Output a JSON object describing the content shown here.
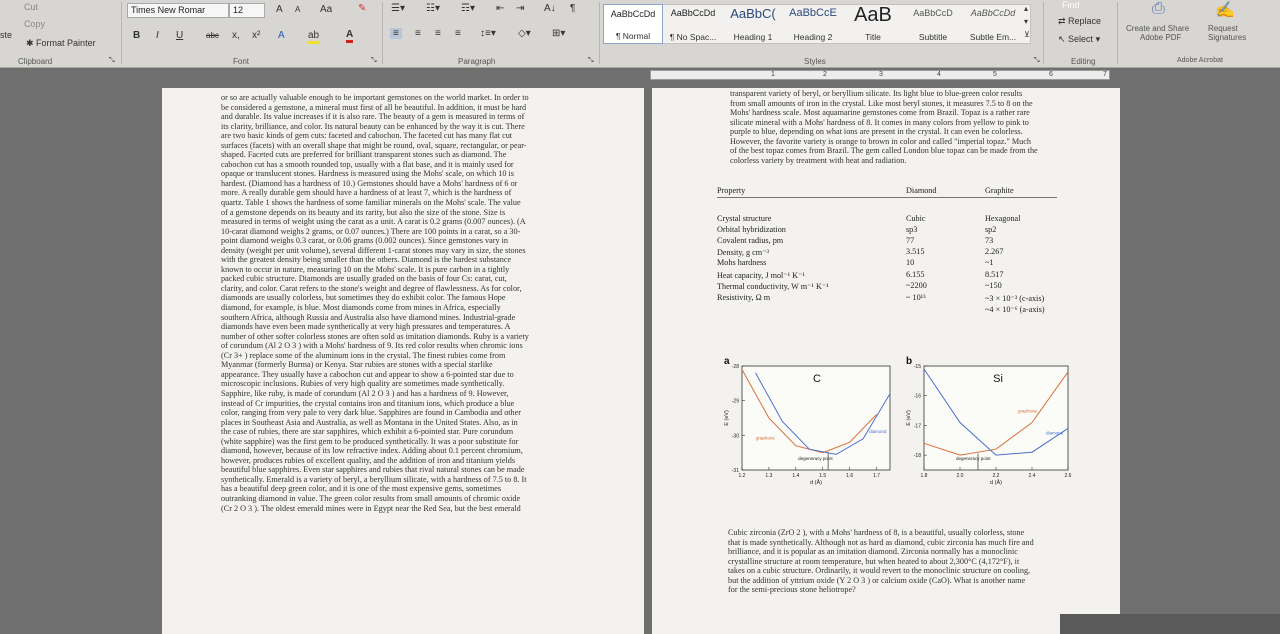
{
  "ribbon": {
    "clipboard": {
      "cut": "Cut",
      "copy": "Copy",
      "paste": "ste",
      "format_painter": "Format Painter",
      "label": "Clipboard"
    },
    "font": {
      "family": "Times New Romar",
      "size": "12",
      "label": "Font",
      "grow": "A",
      "shrink": "A",
      "case": "Aa",
      "bold": "B",
      "italic": "I",
      "underline": "U",
      "strike": "abc",
      "sub": "x,",
      "sup": "x²",
      "text_effects": "A",
      "highlight": "ab",
      "font_color": "A"
    },
    "paragraph": {
      "label": "Paragraph",
      "sort": "A↓",
      "pilcrow": "¶"
    },
    "styles": {
      "label": "Styles",
      "items": [
        {
          "sample": "AaBbCcDd",
          "name": "¶ Normal"
        },
        {
          "sample": "AaBbCcDd",
          "name": "¶ No Spac..."
        },
        {
          "sample": "AaBbC(",
          "name": "Heading 1"
        },
        {
          "sample": "AaBbCcE",
          "name": "Heading 2"
        },
        {
          "sample": "AaB",
          "name": "Title"
        },
        {
          "sample": "AaBbCcD",
          "name": "Subtitle"
        },
        {
          "sample": "AaBbCcDd",
          "name": "Subtle Em..."
        }
      ]
    },
    "editing": {
      "find": "Find",
      "replace": "Replace",
      "select": "Select",
      "label": "Editing"
    },
    "adobe": {
      "create_share": "Create and Share",
      "create_share2": "Adobe PDF",
      "request": "Request",
      "request2": "Signatures",
      "label": "Adobe Acrobat"
    }
  },
  "ruler": {
    "ticks": [
      "1",
      "2",
      "3",
      "4",
      "5",
      "6",
      "7"
    ]
  },
  "left_page": {
    "lines": [
      "or so are actually valuable enough to be important gemstones on the world market. In order to",
      "be considered a gemstone, a mineral must first of all be beautiful. In addition, it must be hard",
      "and durable. Its value increases if it is also rare. The beauty of a gem is measured in terms of",
      "its clarity, brilliance, and color. Its natural beauty can be enhanced by the way it is cut. There",
      "are two basic kinds of gem cuts: faceted and cabochon. The faceted cut has many flat cut",
      "surfaces (facets) with an overall shape that might be round, oval, square, rectangular, or pear-",
      "shaped. Faceted cuts are preferred for brilliant transparent stones such as diamond. The",
      "cabochon cut has a smooth rounded top, usually with a flat base, and it is mainly used for",
      "opaque or translucent stones. Hardness is measured using the Mohs' scale, on which 10 is",
      "hardest. (Diamond has a hardness of 10.) Gemstones should have a Mohs' hardness of 6 or",
      "more. A really durable gem should have a hardness of at least 7, which is the hardness of",
      "quartz. Table 1 shows the hardness of some familiar minerals on the Mohs' scale. The value",
      "of a gemstone depends on its beauty and its rarity, but also the size of the stone. Size is",
      "measured in terms of weight using the carat as a unit. A carat is 0.2 grams (0.007 ounces). (A",
      "10-carat diamond weighs 2 grams, or 0.07 ounces.) There are 100 points in a carat, so a 30-",
      "point diamond weighs 0.3 carat, or 0.06 grams (0.002 ounces). Since gemstones vary in",
      "density (weight per unit volume), several different 1-carat stones may vary in size, the stones",
      "with the greatest density being smaller than the others. Diamond is the hardest substance",
      "known to occur in nature, measuring 10 on the Mohs' scale. It is pure carbon in a tightly",
      "packed cubic structure. Diamonds are usually graded on the basis of four Cs: carat, cut,",
      "clarity, and color. Carat refers to the stone's weight and degree of flawlessness. As for color,",
      "diamonds are usually colorless, but sometimes they do exhibit color. The famous Hope",
      "diamond, for example, is blue. Most diamonds come from mines in Africa, especially",
      "southern Africa, although Russia and Australia also have diamond mines. Industrial-grade",
      "diamonds have even been made synthetically at very high pressures and temperatures. A",
      "number of other softer colorless stones are often sold as imitation diamonds. Ruby is a variety",
      "of corundum (Al 2 O 3 ) with a Mohs' hardness of 9. Its red color results when chromic ions",
      "(Cr 3+ ) replace some of the aluminum ions in the crystal. The finest rubies come from",
      "Myanmar (formerly Burma) or Kenya. Star rubies are stones with a special starlike",
      "appearance. They usually have a cabochon cut and appear to show a 6-pointed star due to",
      "microscopic inclusions. Rubies of very high quality are sometimes made synthetically.",
      "Sapphire, like ruby, is made of corundum (Al 2 O 3 ) and has a hardness of 9. However,",
      "instead of Cr impurities, the crystal contains iron and titanium ions, which produce a blue",
      "color, ranging from very pale to very dark blue. Sapphires are found in Cambodia and other",
      "places in Southeast Asia and Australia, as well as Montana in the United States. Also, as in",
      "the case of rubies, there are star sapphires, which exhibit a 6-pointed star. Pure corundum",
      "(white sapphire) was the first gem to be produced synthetically. It was a poor substitute for",
      "diamond, however, because of its low refractive index. Adding about 0.1 percent chromium,",
      "however, produces rubies of excellent quality, and the addition of iron and titanium yields",
      "beautiful blue sapphires. Even star sapphires and rubies that rival natural stones can be made",
      "synthetically. Emerald is a variety of beryl, a beryllium silicate, with a hardness of 7.5 to 8. It",
      "has a beautiful deep green color, and it is one of the most expensive gems, sometimes",
      "outranking diamond in value. The green color results from small amounts of chromic oxide",
      "(Cr 2 O 3 ). The oldest emerald mines were in Egypt near the Red Sea, but the best emerald"
    ]
  },
  "right_page": {
    "top_lines": [
      "transparent variety of beryl, or beryllium silicate. Its light blue to blue-green color results",
      "from small amounts of iron in the crystal. Like most beryl stones, it measures 7.5 to 8 on the",
      "Mohs' hardness scale. Most aquamarine gemstones come from Brazil. Topaz is a rather rare",
      "silicate mineral with a Mohs' hardness of 8. It comes in many colors from yellow to pink to",
      "purple to blue, depending on what ions are present in the crystal. It can even be colorless.",
      "However, the favorite variety is orange to brown in color and called \"imperial topaz.\" Much",
      "of the best topaz comes from Brazil. The gem called London blue topaz can be made from the",
      "colorless variety by treatment with heat and radiation."
    ],
    "table": {
      "headers": [
        "Property",
        "Diamond",
        "Graphite"
      ],
      "rows": [
        [
          "Crystal structure",
          "Cubic",
          "Hexagonal"
        ],
        [
          "Orbital hybridization",
          "sp3",
          "sp2"
        ],
        [
          "Covalent radius, pm",
          "77",
          "73"
        ],
        [
          "Density, g cm⁻³",
          "3.515",
          "2.267"
        ],
        [
          "Mohs hardness",
          "10",
          "~1"
        ],
        [
          "Heat capacity, J mol⁻¹ K⁻¹",
          "6.155",
          "8.517"
        ],
        [
          "Thermal conductivity, W m⁻¹ K⁻¹",
          "~2200",
          "~150"
        ],
        [
          "Resistivity, Ω m",
          "~ 10¹³",
          "~3 × 10⁻³ (c-axis)"
        ],
        [
          "",
          "",
          "~4 × 10⁻⁶ (a-axis)"
        ]
      ]
    },
    "bottom_lines": [
      "Cubic zirconia (ZrO 2 ), with a Mohs' hardness of 8, is a beautiful, usually colorless, stone",
      "that is made synthetically. Although not as hard as diamond, cubic zirconia has much fire and",
      "brilliance, and it is popular as an imitation diamond. Zirconia normally has a monoclinic",
      "crystalline structure at room temperature, but when heated to about 2,300°C (4,172°F), it",
      "takes on a cubic structure. Ordinarily, it would revert to the monoclinic structure on cooling,",
      "but the addition of yttrium oxide (Y 2 O 3 ) or calcium oxide (CaO). What is another name",
      "for the semi-precious stone heliotrope?"
    ]
  },
  "chart_data": [
    {
      "type": "line",
      "panel": "a",
      "title": "C",
      "xlabel": "d (Å)",
      "ylabel": "E (eV)",
      "x_ticks": [
        "1.2",
        "1.3",
        "1.4",
        "1.5",
        "1.6",
        "1.7"
      ],
      "y_ticks": [
        "-28",
        "-29",
        "-30",
        "-31"
      ],
      "xlim": [
        1.2,
        1.75
      ],
      "ylim": [
        -31,
        -28
      ],
      "annotation": "degeneracy point",
      "series": [
        {
          "name": "graphene",
          "color": "#d9703a",
          "x": [
            1.2,
            1.3,
            1.4,
            1.5,
            1.6,
            1.7
          ],
          "y": [
            -28.1,
            -29.5,
            -30.3,
            -30.5,
            -30.2,
            -29.4
          ]
        },
        {
          "name": "diamond",
          "color": "#4a6fd0",
          "x": [
            1.25,
            1.35,
            1.45,
            1.55,
            1.65,
            1.75
          ],
          "y": [
            -28.2,
            -29.6,
            -30.4,
            -30.55,
            -30.1,
            -28.8
          ]
        }
      ]
    },
    {
      "type": "line",
      "panel": "b",
      "title": "Si",
      "xlabel": "d (Å)",
      "ylabel": "E (eV)",
      "x_ticks": [
        "1.8",
        "2.0",
        "2.2",
        "2.4",
        "2.6"
      ],
      "y_ticks": [
        "-15",
        "-16",
        "-17",
        "-18"
      ],
      "xlim": [
        1.8,
        2.6
      ],
      "ylim": [
        -18.5,
        -15
      ],
      "annotation": "degeneracy point",
      "series": [
        {
          "name": "graphene",
          "color": "#d9703a",
          "x": [
            1.8,
            2.0,
            2.2,
            2.4,
            2.6
          ],
          "y": [
            -17.6,
            -18.0,
            -17.8,
            -16.9,
            -15.2
          ]
        },
        {
          "name": "diamond",
          "color": "#4a6fd0",
          "x": [
            1.8,
            2.0,
            2.2,
            2.4,
            2.6
          ],
          "y": [
            -15.1,
            -16.9,
            -18.0,
            -17.9,
            -17.1
          ]
        }
      ]
    }
  ]
}
